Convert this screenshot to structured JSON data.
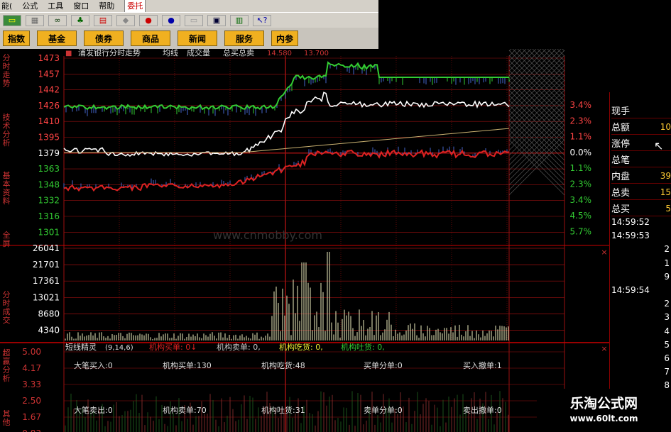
{
  "menu": {
    "items": [
      "能(",
      "公式",
      "工具",
      "窗口",
      "帮助",
      "委托"
    ]
  },
  "toolbar": {
    "icons": [
      "flag-icon",
      "grid-icon",
      "binoculars-icon",
      "tree-icon",
      "chart-icon",
      "diamond-icon",
      "stock-icon",
      "coin-icon",
      "blank-icon",
      "window-icon",
      "books-icon",
      "help-cursor-icon"
    ]
  },
  "nav": {
    "buttons": [
      "指数",
      "基金",
      "债券",
      "商品",
      "新闻",
      "服务",
      "内参"
    ]
  },
  "chart_header": {
    "title": "浦发银行分时走势",
    "avg": "均线",
    "volume": "成交量",
    "buysell": "总买总卖",
    "v1": "14.580",
    "v2": "13.700"
  },
  "side_tabs": [
    "分时走势",
    "技术分析",
    "基本资料",
    "全屏",
    "分时成交",
    "超赢分析",
    "其他"
  ],
  "price_axis": [
    "1473",
    "1457",
    "1442",
    "1426",
    "1410",
    "1395",
    "1379",
    "1363",
    "1348",
    "1332",
    "1316",
    "1301"
  ],
  "pct_axis": [
    "3.4%",
    "2.3%",
    "1.1%",
    "0.0%",
    "1.1%",
    "2.3%",
    "3.4%",
    "4.5%",
    "5.7%"
  ],
  "volume_axis": [
    "26041",
    "21701",
    "17361",
    "13021",
    "8680",
    "4340"
  ],
  "lower_axis": [
    "5.00",
    "4.17",
    "3.33",
    "2.50",
    "1.67",
    "0.83"
  ],
  "indicator": {
    "title": "短线精灵",
    "params": "(9,14,6)",
    "buy": "机构买单: 0↓",
    "sell": "机构卖单: 0,",
    "eat": "机构吃货: 0,",
    "spit": "机构吐货: 0,"
  },
  "stats": {
    "row1": [
      {
        "label": "大笔买入",
        "value": "0"
      },
      {
        "label": "机构买单",
        "value": "130"
      },
      {
        "label": "机构吃货",
        "value": "48"
      },
      {
        "label": "买单分单",
        "value": "0"
      },
      {
        "label": "买入撤单",
        "value": "1"
      }
    ],
    "row2": [
      {
        "label": "大笔卖出",
        "value": "0"
      },
      {
        "label": "机构卖单",
        "value": "70"
      },
      {
        "label": "机构吐货",
        "value": "31"
      },
      {
        "label": "卖单分单",
        "value": "0"
      },
      {
        "label": "卖出撤单",
        "value": "0"
      }
    ]
  },
  "watermark": "www.cnmobby.com",
  "right_panel": {
    "rows": [
      {
        "label": "现手",
        "value": ""
      },
      {
        "label": "总额",
        "value": "10"
      },
      {
        "label": "涨停",
        "value": ""
      },
      {
        "label": "总笔",
        "value": ""
      },
      {
        "label": "内盘",
        "value": "39"
      },
      {
        "label": "总卖",
        "value": "15"
      },
      {
        "label": "总买",
        "value": "5"
      }
    ],
    "ticks": [
      {
        "t": "14:59:52",
        "kind": "time"
      },
      {
        "t": "14:59:53",
        "kind": "time"
      },
      {
        "t": "2",
        "kind": "num"
      },
      {
        "t": "1",
        "kind": "num"
      },
      {
        "t": "9",
        "kind": "num"
      },
      {
        "t": "14:59:54",
        "kind": "time"
      },
      {
        "t": "2",
        "kind": "num"
      },
      {
        "t": "3",
        "kind": "num"
      },
      {
        "t": "4",
        "kind": "num"
      },
      {
        "t": "5",
        "kind": "num"
      },
      {
        "t": "6",
        "kind": "num"
      },
      {
        "t": "7",
        "kind": "num"
      },
      {
        "t": "8",
        "kind": "num"
      }
    ]
  },
  "logo": {
    "name": "乐淘公式网",
    "url": "www.60lt.com"
  },
  "colors": {
    "grid": "#9b1010",
    "price": "#ffffff",
    "avg": "#c8b070",
    "green_line": "#33cc33",
    "red_line": "#dd2222",
    "axis_up": "#ff3333",
    "axis_down": "#33cc33",
    "volume": "#c8c8a0"
  }
}
